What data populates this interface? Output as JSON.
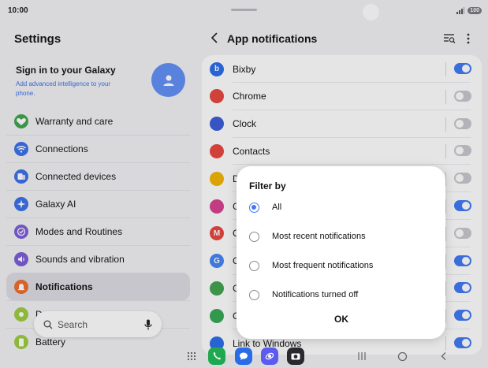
{
  "status_bar": {
    "time": "10:00",
    "battery": "100"
  },
  "left_pane": {
    "title": "Settings",
    "signin": {
      "title": "Sign in to your Galaxy",
      "subtitle": "Add advanced intelligence to your phone."
    },
    "items": [
      {
        "label": "Warranty and care",
        "icon": "heart-shield-icon",
        "color": "#3fa34d"
      },
      {
        "label": "Connections",
        "icon": "wifi-icon",
        "color": "#3a6ee8"
      },
      {
        "label": "Connected devices",
        "icon": "devices-icon",
        "color": "#3a6ee8"
      },
      {
        "label": "Galaxy AI",
        "icon": "sparkle-icon",
        "color": "#3a6ee8"
      },
      {
        "label": "Modes and Routines",
        "icon": "check-circle-icon",
        "color": "#7b5bd6"
      },
      {
        "label": "Sounds and vibration",
        "icon": "speaker-icon",
        "color": "#7b5bd6"
      },
      {
        "label": "Notifications",
        "icon": "bell-icon",
        "color": "#f06a2a",
        "selected": true
      },
      {
        "label": "D",
        "icon": "display-icon",
        "color": "#9ccc3c"
      },
      {
        "label": "Battery",
        "icon": "battery-icon",
        "color": "#9ccc3c"
      }
    ],
    "search": {
      "label": "Search"
    }
  },
  "right_pane": {
    "title": "App notifications",
    "apps": [
      {
        "name": "Bixby",
        "icon": "bixby-icon",
        "color": "#2a6be8",
        "enabled": true
      },
      {
        "name": "Chrome",
        "icon": "chrome-icon",
        "color": "#e8453c",
        "enabled": false
      },
      {
        "name": "Clock",
        "icon": "clock-icon",
        "color": "#3a5bd6",
        "enabled": false
      },
      {
        "name": "Contacts",
        "icon": "contacts-icon",
        "color": "#e8453c",
        "enabled": false
      },
      {
        "name": "D",
        "icon": "drive-icon",
        "color": "#f4b400",
        "enabled": false
      },
      {
        "name": "G",
        "icon": "gallery-icon",
        "color": "#d63f8c",
        "enabled": true
      },
      {
        "name": "G",
        "icon": "gmail-icon",
        "color": "#e8453c",
        "enabled": false
      },
      {
        "name": "G",
        "icon": "google-icon",
        "color": "#4285f4",
        "enabled": true
      },
      {
        "name": "G",
        "icon": "galaxy-store-icon",
        "color": "#3fa34d",
        "enabled": true
      },
      {
        "name": "G",
        "icon": "play-store-icon",
        "color": "#34a853",
        "enabled": true
      },
      {
        "name": "Link to Windows",
        "icon": "link-windows-icon",
        "color": "#2a6be8",
        "enabled": true
      }
    ]
  },
  "dialog": {
    "title": "Filter by",
    "options": [
      {
        "label": "All",
        "checked": true
      },
      {
        "label": "Most recent notifications",
        "checked": false
      },
      {
        "label": "Most frequent notifications",
        "checked": false
      },
      {
        "label": "Notifications turned off",
        "checked": false
      }
    ],
    "ok_label": "OK"
  },
  "dock": {
    "apps": [
      {
        "icon": "phone-icon",
        "color": "#1fa84f"
      },
      {
        "icon": "messages-icon",
        "color": "#2a6be8"
      },
      {
        "icon": "internet-icon",
        "color": "#5b5bf0"
      },
      {
        "icon": "camera-icon",
        "color": "#2a2a2e"
      }
    ]
  }
}
